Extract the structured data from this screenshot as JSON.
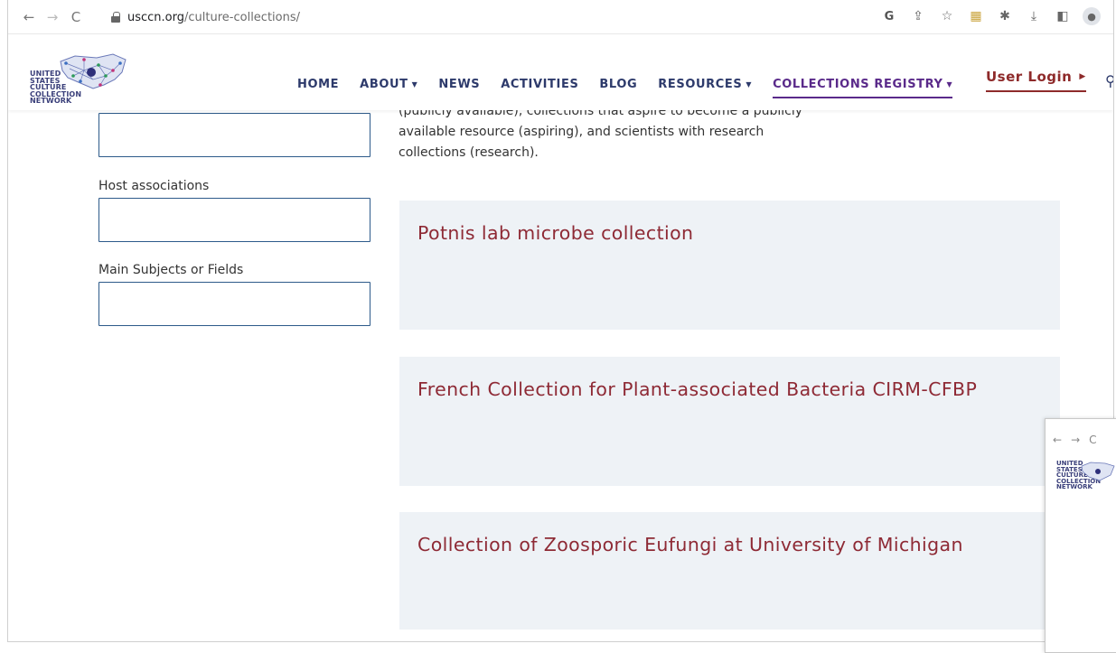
{
  "browser": {
    "url_domain": "usccn.org",
    "url_path": "/culture-collections/",
    "back_label": "←",
    "forward_label": "→",
    "reload_label": "C"
  },
  "logo": {
    "lines": [
      "UNITED",
      "STATES",
      "CULTURE",
      "COLLECTION",
      "NETWORK"
    ]
  },
  "nav": {
    "home": "HOME",
    "about": "ABOUT",
    "news": "NEWS",
    "activities": "ACTIVITIES",
    "blog": "BLOG",
    "resources": "RESOURCES",
    "collections_registry": "COLLECTIONS REGISTRY",
    "user_login": "User Login"
  },
  "filters": {
    "host_associations_label": "Host associations",
    "main_subjects_label": "Main Subjects or Fields"
  },
  "intro": {
    "line1": "(publicly available), collections that aspire to become a publicly",
    "line2": "available resource (aspiring), and scientists with research",
    "line3": "collections (research)."
  },
  "collections": [
    {
      "title": "Potnis lab microbe collection"
    },
    {
      "title": "French Collection for Plant-associated Bacteria CIRM-CFBP"
    },
    {
      "title": "Collection of Zoosporic Eufungi at University of Michigan"
    }
  ],
  "colors": {
    "nav_text": "#2d3a6b",
    "active_nav": "#5a2a8a",
    "card_title": "#8e2a35",
    "card_bg": "#eef2f6",
    "input_border": "#2d5a8a"
  }
}
